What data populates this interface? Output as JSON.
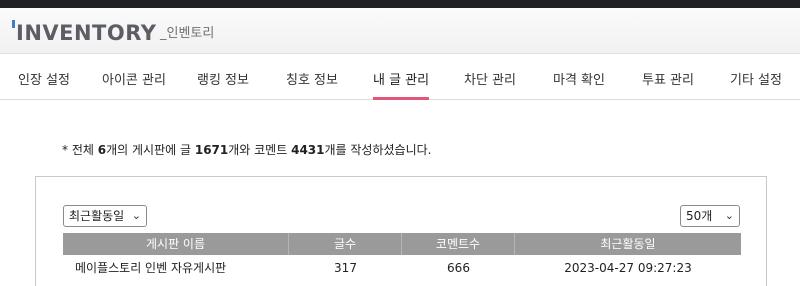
{
  "header": {
    "logo": "INVENTORY",
    "logo_sub": "_인벤토리"
  },
  "nav": {
    "items": [
      {
        "label": "인장 설정"
      },
      {
        "label": "아이콘 관리"
      },
      {
        "label": "랭킹 정보"
      },
      {
        "label": "칭호 정보"
      },
      {
        "label": "내 글 관리",
        "active": true
      },
      {
        "label": "차단 관리"
      },
      {
        "label": "마격 확인"
      },
      {
        "label": "투표 관리"
      },
      {
        "label": "기타 설정"
      }
    ],
    "active_color": "#e1577a"
  },
  "summary": {
    "prefix": "* 전체",
    "boards": "6",
    "part1": "개의 게시판에 글",
    "posts": "1671",
    "part2": "개와 코멘트",
    "comments": "4431",
    "part3": "개를 작성하셨습니다."
  },
  "controls": {
    "sort_selected": "최근활동일",
    "page_size_selected": "50개"
  },
  "table": {
    "headers": [
      "게시판 이름",
      "글수",
      "코멘트수",
      "최근활동일"
    ],
    "rows": [
      {
        "board": "메이플스토리 인벤 자유게시판",
        "posts": "317",
        "comments": "666",
        "last_active": "2023-04-27 09:27:23"
      }
    ]
  }
}
